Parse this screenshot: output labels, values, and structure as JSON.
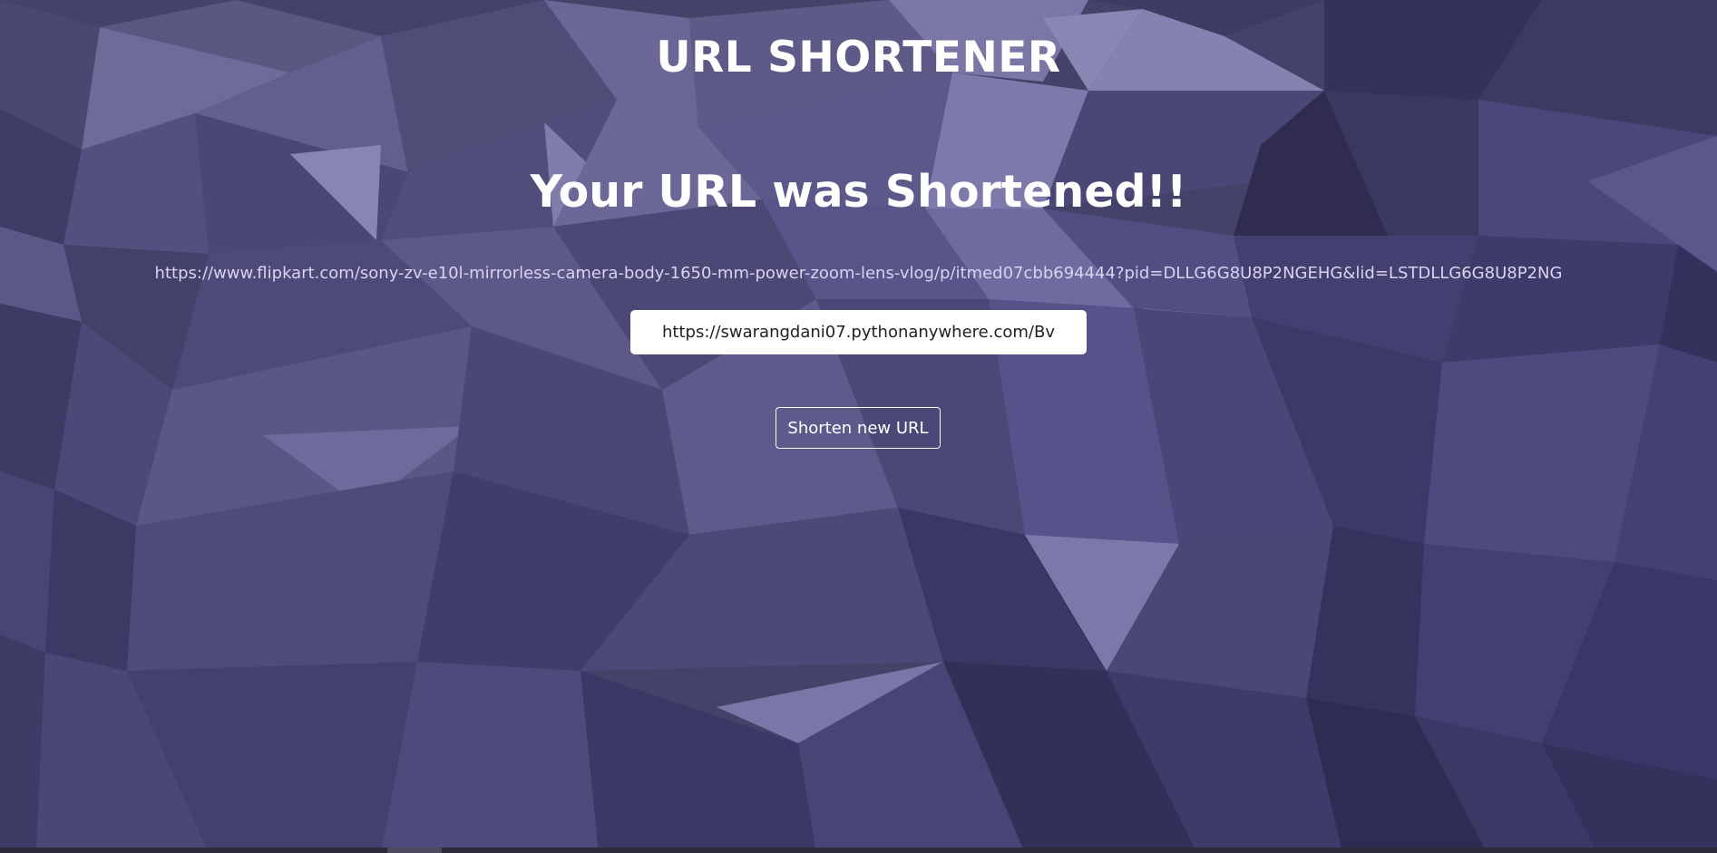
{
  "app": {
    "title": "URL SHORTENER"
  },
  "result": {
    "heading": "Your URL was Shortened!!",
    "original_url": "https://www.flipkart.com/sony-zv-e10l-mirrorless-camera-body-1650-mm-power-zoom-lens-vlog/p/itmed07cbb694444?pid=DLLG6G8U8P2NGEHG&lid=LSTDLLG6G8U8P2NG",
    "short_url": "https://swarangdani07.pythonanywhere.com/Bv"
  },
  "actions": {
    "shorten_new_label": "Shorten new URL"
  },
  "colors": {
    "background": "#45426a",
    "title_text": "#ffffff",
    "original_url_text": "#d9d3ef",
    "input_background": "#ffffff",
    "button_border": "#ffffff"
  }
}
